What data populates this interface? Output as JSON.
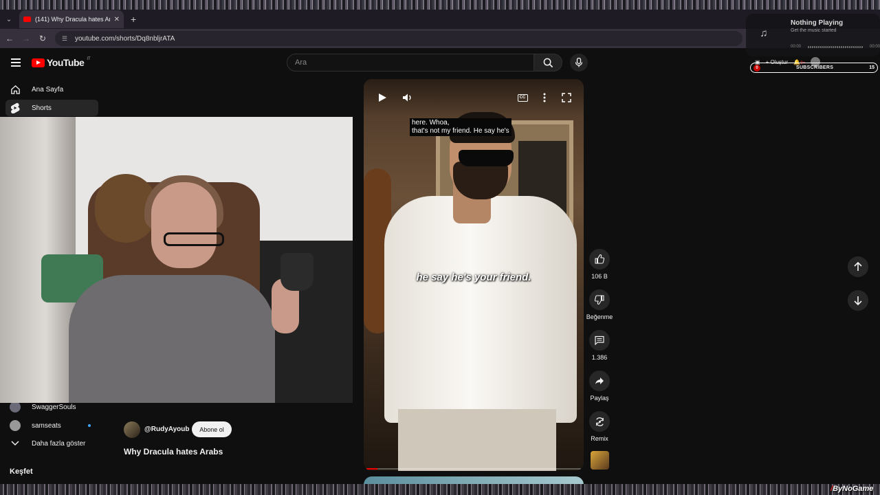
{
  "browser": {
    "tab_title": "(141) Why Dracula hates Arabs",
    "url": "youtube.com/shorts/Dq8nbljrATA"
  },
  "header": {
    "logo_text": "YouTube",
    "logo_country": "IT",
    "search_placeholder": "Ara",
    "create_label": "Oluştur",
    "notifications_badge": "9+"
  },
  "music_widget": {
    "title": "Nothing Playing",
    "subtitle": "Get the music started",
    "time_start": "00:00",
    "time_end": "00:00"
  },
  "subscriber_bar": {
    "left_count": "0",
    "label": "SUBSCRIBERS",
    "right_count": "15"
  },
  "sidebar": {
    "items": [
      {
        "label": "Ana Sayfa",
        "icon": "home-icon"
      },
      {
        "label": "Shorts",
        "icon": "shorts-icon"
      }
    ],
    "subscriptions": [
      {
        "label": "SwaggerSouls"
      },
      {
        "label": "samseats"
      }
    ],
    "show_more": "Daha fazla göster",
    "explore_heading": "Keşfet"
  },
  "video": {
    "caption_top_line1": "here. Whoa,",
    "caption_top_line2": "that's not my friend. He say he's",
    "caption_burned": "he say he's your friend.",
    "progress": 0.05,
    "cc_label": "CC"
  },
  "actions": {
    "like_count": "106 B",
    "dislike_label": "Beğenme",
    "comment_count": "1.386",
    "share_label": "Paylaş",
    "remix_label": "Remix"
  },
  "info": {
    "channel": "@RudyAyoub",
    "subscribe_label": "Abone ol",
    "title": "Why Dracula hates Arabs"
  },
  "watermark": {
    "slash": "/",
    "text": "ByNoGame"
  },
  "colors": {
    "accent": "#ff0000",
    "background": "#0f0f0f"
  }
}
